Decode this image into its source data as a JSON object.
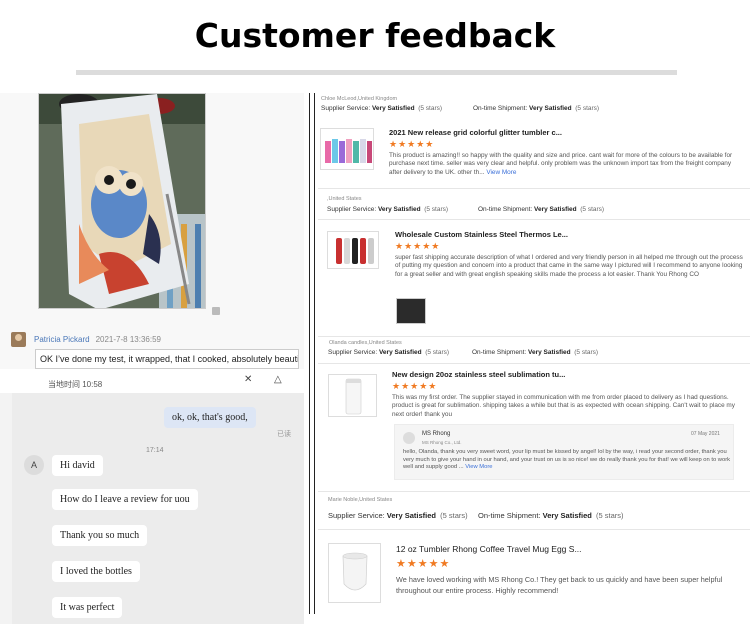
{
  "title": "Customer feedback",
  "chat": {
    "sender_name": "Patricia Pickard",
    "sender_time": "2021-7-8 13:36:59",
    "message": "OK I’ve done my test, it wrapped, that I cooked, absolutely beautiful",
    "toolbar_text": "当地时间 10:58",
    "my_message": "ok,  ok,  that's good,",
    "read_mark": "已读",
    "time_divider": "17:14",
    "avatar_letter": "A",
    "bubbles": [
      "Hi david",
      "How do I leave a review for uou",
      "Thank you so much",
      "I loved the bottles",
      "It was perfect"
    ]
  },
  "reviews": [
    {
      "reviewer": "Chloe McLeod,United Kingdom",
      "supplier_label": "Supplier Service:",
      "supplier_value": "Very Satisfied",
      "supplier_stars": "(5 stars)",
      "shipment_label": "On-time Shipment:",
      "shipment_value": "Very Satisfied",
      "shipment_stars": "(5 stars)",
      "product": "2021 New release grid colorful glitter tumbler c...",
      "stars": "★★★★★",
      "text": "This product is amazing!! so happy with the quality and size and price. cant wait for more of the colours to be available for purchase next time. seller was very clear and helpful. only problem was the unknown import tax from the freight company after delivery to the UK. other th...",
      "more": "View More"
    },
    {
      "reviewer": ",United States",
      "supplier_label": "Supplier Service:",
      "supplier_value": "Very Satisfied",
      "supplier_stars": "(5 stars)",
      "shipment_label": "On-time Shipment:",
      "shipment_value": "Very Satisfied",
      "shipment_stars": "(5 stars)",
      "product": "Wholesale Custom Stainless Steel Thermos Le...",
      "stars": "★★★★★",
      "text": "super fast shipping accurate description of what I ordered and very friendly person in all helped me through out the process of putting my question and concern into a product that came in the same way I pictured will I recommend to anyone looking for a great seller and with great english speaking skills made the process a lot easier. Thank You Rhong CO"
    },
    {
      "reviewer": "Olanda candles,United States",
      "supplier_label": "Supplier Service:",
      "supplier_value": "Very Satisfied",
      "supplier_stars": "(5 stars)",
      "shipment_label": "On-time Shipment:",
      "shipment_value": "Very Satisfied",
      "shipment_stars": "(5 stars)",
      "product": "New design 20oz stainless steel sublimation tu...",
      "stars": "★★★★★",
      "text": "This was my first order. The supplier stayed in communication with me from order placed to delivery as I had questions. product is great for sublimation. shipping takes a while but that is as expected with ocean shipping. Can't wait to place my next order! thank you",
      "reply": {
        "name": "MS Rhong",
        "company": "MS Rhong Co., Ltd.",
        "date": "07 May 2021",
        "text": "hello, Olanda, thank you very sweet word, your lip must be kissed by angel! lol by the way, i read your second order, thank you very much to give your hand in our hand, and your trust on us is so nice! we do really thank you for that! we will keep on to work well and supply good ...",
        "more": "View More"
      }
    },
    {
      "reviewer": "Marie Noble,United States",
      "supplier_label": "Supplier Service:",
      "supplier_value": "Very Satisfied",
      "supplier_stars": "(5 stars)",
      "shipment_label": "On-time Shipment:",
      "shipment_value": "Very Satisfied",
      "shipment_stars": "(5 stars)",
      "product": "12 oz Tumbler Rhong Coffee Travel Mug Egg S...",
      "stars": "★★★★★",
      "text": "We have loved working with MS Rhong Co.! They get back to us quickly and have been super helpful throughout our entire process. Highly recommend!"
    }
  ]
}
